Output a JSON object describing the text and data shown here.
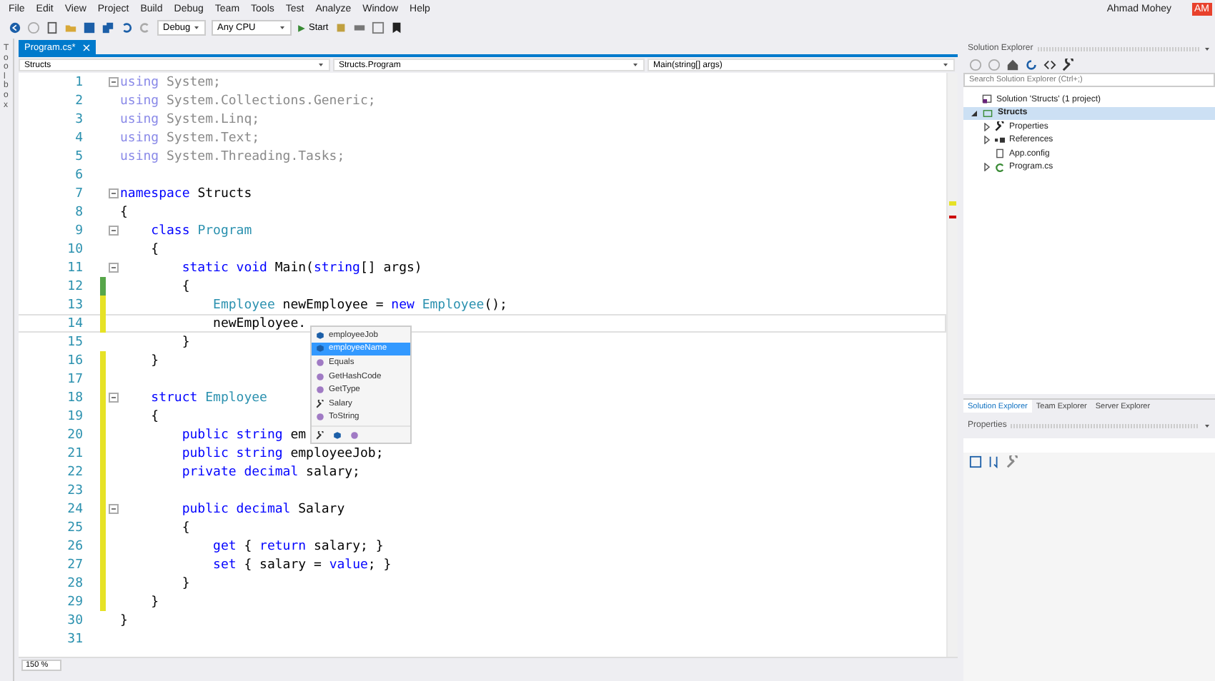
{
  "menu": [
    "File",
    "Edit",
    "View",
    "Project",
    "Build",
    "Debug",
    "Team",
    "Tools",
    "Test",
    "Analyze",
    "Window",
    "Help"
  ],
  "user": {
    "name": "Ahmad Mohey",
    "initials": "AM"
  },
  "toolbar": {
    "configuration": "Debug",
    "platform": "Any CPU",
    "start": "Start"
  },
  "toolbox_label": "Toolbox",
  "tabs": [
    {
      "label": "Program.cs*",
      "selected": true
    }
  ],
  "navigation": [
    "Structs",
    "Structs.Program",
    "Main(string[] args)"
  ],
  "code": [
    {
      "number": "1",
      "fold": true,
      "modified": false,
      "current": false,
      "tokens": [
        {
          "kind": "faded_kw",
          "text": "using"
        },
        {
          "kind": "faded",
          "text": " System;"
        }
      ]
    },
    {
      "number": "2",
      "fold": false,
      "modified": false,
      "current": false,
      "tokens": [
        {
          "kind": "faded_kw",
          "text": "using"
        },
        {
          "kind": "faded",
          "text": " System.Collections.Generic;"
        }
      ]
    },
    {
      "number": "3",
      "fold": false,
      "modified": false,
      "current": false,
      "tokens": [
        {
          "kind": "faded_kw",
          "text": "using"
        },
        {
          "kind": "faded",
          "text": " System.Linq;"
        }
      ]
    },
    {
      "number": "4",
      "fold": false,
      "modified": false,
      "current": false,
      "tokens": [
        {
          "kind": "faded_kw",
          "text": "using"
        },
        {
          "kind": "faded",
          "text": " System.Text;"
        }
      ]
    },
    {
      "number": "5",
      "fold": false,
      "modified": false,
      "current": false,
      "tokens": [
        {
          "kind": "faded_kw",
          "text": "using"
        },
        {
          "kind": "faded",
          "text": " System.Threading.Tasks;"
        }
      ]
    },
    {
      "number": "6",
      "fold": false,
      "modified": false,
      "current": false
    },
    {
      "number": "7",
      "fold": true,
      "modified": false,
      "current": false,
      "tokens": [
        {
          "kind": "kw",
          "text": "namespace"
        },
        {
          "kind": "text",
          "text": " Structs"
        }
      ]
    },
    {
      "number": "8",
      "fold": false,
      "modified": false,
      "current": false,
      "tokens": [
        {
          "kind": "text",
          "text": "{"
        }
      ]
    },
    {
      "number": "9",
      "fold": true,
      "modified": false,
      "current": false,
      "tokens": [
        {
          "kind": "kw",
          "text": "    class"
        },
        {
          "kind": "type",
          "text": " Program"
        }
      ]
    },
    {
      "number": "10",
      "fold": false,
      "modified": false,
      "current": false,
      "tokens": [
        {
          "kind": "text",
          "text": "    {"
        }
      ]
    },
    {
      "number": "11",
      "fold": true,
      "modified": false,
      "current": false,
      "tokens": [
        {
          "kind": "kw",
          "text": "        static void"
        },
        {
          "kind": "text",
          "text": " Main("
        },
        {
          "kind": "kw",
          "text": "string"
        },
        {
          "kind": "text",
          "text": "[] args)"
        }
      ]
    },
    {
      "number": "12",
      "fold": false,
      "modified": true,
      "saved": true,
      "current": false,
      "tokens": [
        {
          "kind": "text",
          "text": "        {"
        }
      ]
    },
    {
      "number": "13",
      "fold": false,
      "modified": true,
      "saved": false,
      "current": false,
      "tokens": [
        {
          "kind": "type",
          "text": "            Employee"
        },
        {
          "kind": "text",
          "text": " newEmployee = "
        },
        {
          "kind": "kw",
          "text": "new"
        },
        {
          "kind": "type",
          "text": " Employee"
        },
        {
          "kind": "text",
          "text": "();"
        }
      ]
    },
    {
      "number": "14",
      "fold": false,
      "modified": true,
      "saved": false,
      "current": true,
      "tokens": [
        {
          "kind": "text",
          "text": "            newEmployee."
        }
      ]
    },
    {
      "number": "15",
      "fold": false,
      "modified": false,
      "current": false,
      "tokens": [
        {
          "kind": "text",
          "text": "        }"
        }
      ]
    },
    {
      "number": "16",
      "fold": false,
      "modified": true,
      "saved": false,
      "current": false,
      "tokens": [
        {
          "kind": "text",
          "text": "    }"
        }
      ]
    },
    {
      "number": "17",
      "fold": false,
      "modified": true,
      "saved": false,
      "current": false
    },
    {
      "number": "18",
      "fold": true,
      "modified": true,
      "saved": false,
      "current": false,
      "tokens": [
        {
          "kind": "kw",
          "text": "    struct"
        },
        {
          "kind": "type",
          "text": " Employee"
        }
      ]
    },
    {
      "number": "19",
      "fold": false,
      "modified": true,
      "saved": false,
      "current": false,
      "tokens": [
        {
          "kind": "text",
          "text": "    {"
        }
      ]
    },
    {
      "number": "20",
      "fold": false,
      "modified": true,
      "saved": false,
      "current": false,
      "tokens": [
        {
          "kind": "kw",
          "text": "        public string"
        },
        {
          "kind": "text",
          "text": " em"
        }
      ]
    },
    {
      "number": "21",
      "fold": false,
      "modified": true,
      "saved": false,
      "current": false,
      "tokens": [
        {
          "kind": "kw",
          "text": "        public string"
        },
        {
          "kind": "text",
          "text": " employeeJob;"
        }
      ]
    },
    {
      "number": "22",
      "fold": false,
      "modified": true,
      "saved": false,
      "current": false,
      "tokens": [
        {
          "kind": "kw",
          "text": "        private decimal"
        },
        {
          "kind": "text",
          "text": " salary;"
        }
      ]
    },
    {
      "number": "23",
      "fold": false,
      "modified": true,
      "saved": false,
      "current": false
    },
    {
      "number": "24",
      "fold": true,
      "modified": true,
      "saved": false,
      "current": false,
      "tokens": [
        {
          "kind": "kw",
          "text": "        public decimal"
        },
        {
          "kind": "text",
          "text": " Salary"
        }
      ]
    },
    {
      "number": "25",
      "fold": false,
      "modified": true,
      "saved": false,
      "current": false,
      "tokens": [
        {
          "kind": "text",
          "text": "        {"
        }
      ]
    },
    {
      "number": "26",
      "fold": false,
      "modified": true,
      "saved": false,
      "current": false,
      "tokens": [
        {
          "kind": "kw",
          "text": "            get"
        },
        {
          "kind": "text",
          "text": " { "
        },
        {
          "kind": "kw",
          "text": "return"
        },
        {
          "kind": "text",
          "text": " salary; }"
        }
      ]
    },
    {
      "number": "27",
      "fold": false,
      "modified": true,
      "saved": false,
      "current": false,
      "tokens": [
        {
          "kind": "kw",
          "text": "            set"
        },
        {
          "kind": "text",
          "text": " { salary = "
        },
        {
          "kind": "kw",
          "text": "value"
        },
        {
          "kind": "text",
          "text": "; }"
        }
      ]
    },
    {
      "number": "28",
      "fold": false,
      "modified": true,
      "saved": false,
      "current": false,
      "tokens": [
        {
          "kind": "text",
          "text": "        }"
        }
      ]
    },
    {
      "number": "29",
      "fold": false,
      "modified": true,
      "saved": false,
      "current": false,
      "tokens": [
        {
          "kind": "text",
          "text": "    }"
        }
      ]
    },
    {
      "number": "30",
      "fold": false,
      "modified": false,
      "current": false,
      "tokens": [
        {
          "kind": "text",
          "text": "}"
        }
      ]
    },
    {
      "number": "31",
      "fold": false,
      "modified": false,
      "current": false
    }
  ],
  "completion": {
    "items": [
      {
        "label": "employeeJob",
        "kind": "field",
        "selected": false
      },
      {
        "label": "employeeName",
        "kind": "field",
        "selected": true
      },
      {
        "label": "Equals",
        "kind": "method",
        "selected": false
      },
      {
        "label": "GetHashCode",
        "kind": "method",
        "selected": false
      },
      {
        "label": "GetType",
        "kind": "method",
        "selected": false
      },
      {
        "label": "Salary",
        "kind": "property",
        "selected": false
      },
      {
        "label": "ToString",
        "kind": "method",
        "selected": false
      }
    ],
    "filters": [
      {
        "kind": "property"
      },
      {
        "kind": "field"
      },
      {
        "kind": "method"
      }
    ]
  },
  "zoom": "150 %",
  "solution_explorer": {
    "title": "Solution Explorer",
    "search": {
      "placeholder": "Search Solution Explorer (Ctrl+;)"
    },
    "tree": [
      {
        "label": "Solution 'Structs' (1 project)",
        "kind": "solution",
        "selected": false,
        "children": [
          {
            "label": "Structs",
            "kind": "project",
            "expanded": true,
            "selected": true,
            "children": [
              {
                "label": "Properties",
                "kind": "wrench",
                "expanded": false,
                "selected": false
              },
              {
                "label": "References",
                "kind": "references",
                "expanded": false,
                "selected": false
              },
              {
                "label": "App.config",
                "kind": "config",
                "selected": false
              },
              {
                "label": "Program.cs",
                "kind": "csharp",
                "expanded": false,
                "selected": false
              }
            ]
          }
        ]
      }
    ]
  },
  "panel_tabs": [
    {
      "label": "Solution Explorer",
      "selected": true
    },
    {
      "label": "Team Explorer",
      "selected": false
    },
    {
      "label": "Server Explorer",
      "selected": false
    }
  ],
  "properties": {
    "title": "Properties"
  }
}
